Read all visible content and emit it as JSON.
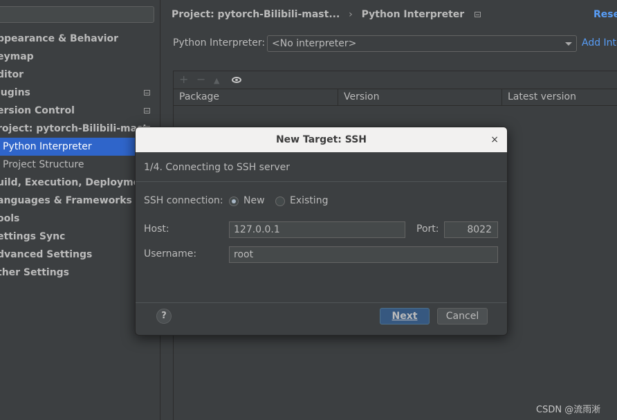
{
  "sidebar": {
    "items": [
      {
        "label": "ppearance & Behavior",
        "badge": false
      },
      {
        "label": "eymap",
        "badge": false
      },
      {
        "label": "ditor",
        "badge": false
      },
      {
        "label": "lugins",
        "badge": true
      },
      {
        "label": "ersion Control",
        "badge": true
      },
      {
        "label": "roject: pytorch-Bilibili-mast",
        "badge": true
      },
      {
        "label": "Python Interpreter",
        "badge": false,
        "selected": true
      },
      {
        "label": "Project Structure",
        "badge": false
      },
      {
        "label": "uild, Execution, Deploymen",
        "badge": false
      },
      {
        "label": "anguages & Frameworks",
        "badge": false
      },
      {
        "label": "ools",
        "badge": false
      },
      {
        "label": "ettings Sync",
        "badge": false
      },
      {
        "label": "dvanced Settings",
        "badge": false
      },
      {
        "label": "ther Settings",
        "badge": false
      }
    ]
  },
  "header": {
    "crumb_project": "Project: pytorch-Bilibili-mast...",
    "crumb_separator": "›",
    "crumb_page": "Python Interpreter",
    "reset_label": "Rese"
  },
  "interpreter": {
    "label": "Python Interpreter:",
    "value": "<No interpreter>",
    "add_label": "Add Inte"
  },
  "packages": {
    "toolbar": {
      "add": "+",
      "remove": "−",
      "up": "▲"
    },
    "columns": [
      "Package",
      "Version",
      "Latest version"
    ]
  },
  "dialog": {
    "title": "New Target: SSH",
    "close": "×",
    "step": "1/4. Connecting to SSH server",
    "ssh_connection_label": "SSH connection:",
    "option_new": "New",
    "option_existing": "Existing",
    "selected_option": "New",
    "host_label": "Host:",
    "host_value": "127.0.0.1",
    "port_label": "Port:",
    "port_value": "8022",
    "username_label": "Username:",
    "username_value": "root",
    "help": "?",
    "next_label": "Next",
    "cancel_label": "Cancel"
  },
  "watermark": "CSDN @流雨淅"
}
